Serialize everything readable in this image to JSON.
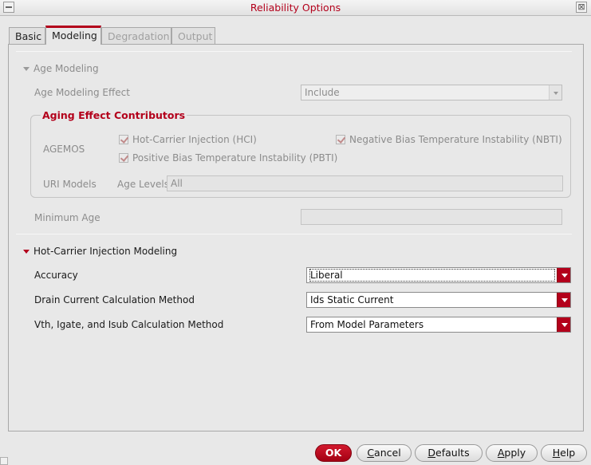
{
  "window": {
    "title": "Reliability Options",
    "close_glyph": "⊠"
  },
  "tabs": [
    {
      "label": "Basic",
      "state": "normal"
    },
    {
      "label": "Modeling",
      "state": "active"
    },
    {
      "label": "Degradation",
      "state": "disabled"
    },
    {
      "label": "Output",
      "state": "disabled"
    }
  ],
  "age_section": {
    "header": "Age Modeling",
    "effect_label": "Age Modeling Effect",
    "effect_value": "Include",
    "group_title": "Aging Effect Contributors",
    "agemos_label": "AGEMOS",
    "checkboxes": [
      {
        "label": "Hot-Carrier Injection (HCI)",
        "checked": true
      },
      {
        "label": "Negative Bias Temperature Instability (NBTI)",
        "checked": true
      },
      {
        "label": "Positive Bias Temperature Instability (PBTI)",
        "checked": true
      }
    ],
    "uri_label": "URI Models",
    "age_levels_label": "Age Levels",
    "age_levels_value": "All",
    "min_age_label": "Minimum Age",
    "min_age_value": ""
  },
  "hci_section": {
    "header": "Hot-Carrier Injection Modeling",
    "rows": [
      {
        "label": "Accuracy",
        "value": "Liberal"
      },
      {
        "label": "Drain Current Calculation Method",
        "value": "Ids Static Current"
      },
      {
        "label": "Vth, Igate, and Isub Calculation Method",
        "value": "From Model Parameters"
      }
    ]
  },
  "buttons": {
    "ok": {
      "label": "OK",
      "mnemonic": "O"
    },
    "cancel": {
      "pre": "",
      "mnemonic": "C",
      "post": "ancel"
    },
    "defaults": {
      "pre": "",
      "mnemonic": "D",
      "post": "efaults"
    },
    "apply": {
      "pre": "",
      "mnemonic": "A",
      "post": "pply"
    },
    "help": {
      "pre": "",
      "mnemonic": "H",
      "post": "elp"
    }
  },
  "colors": {
    "accent": "#b3001b",
    "disabled_text": "#8c8c8c",
    "background": "#e8e8e8"
  },
  "icons": [
    "window-menu-icon",
    "close-icon",
    "collapse-triangle-icon",
    "dropdown-arrow-icon",
    "checkmark-icon",
    "resize-grip-icon"
  ]
}
